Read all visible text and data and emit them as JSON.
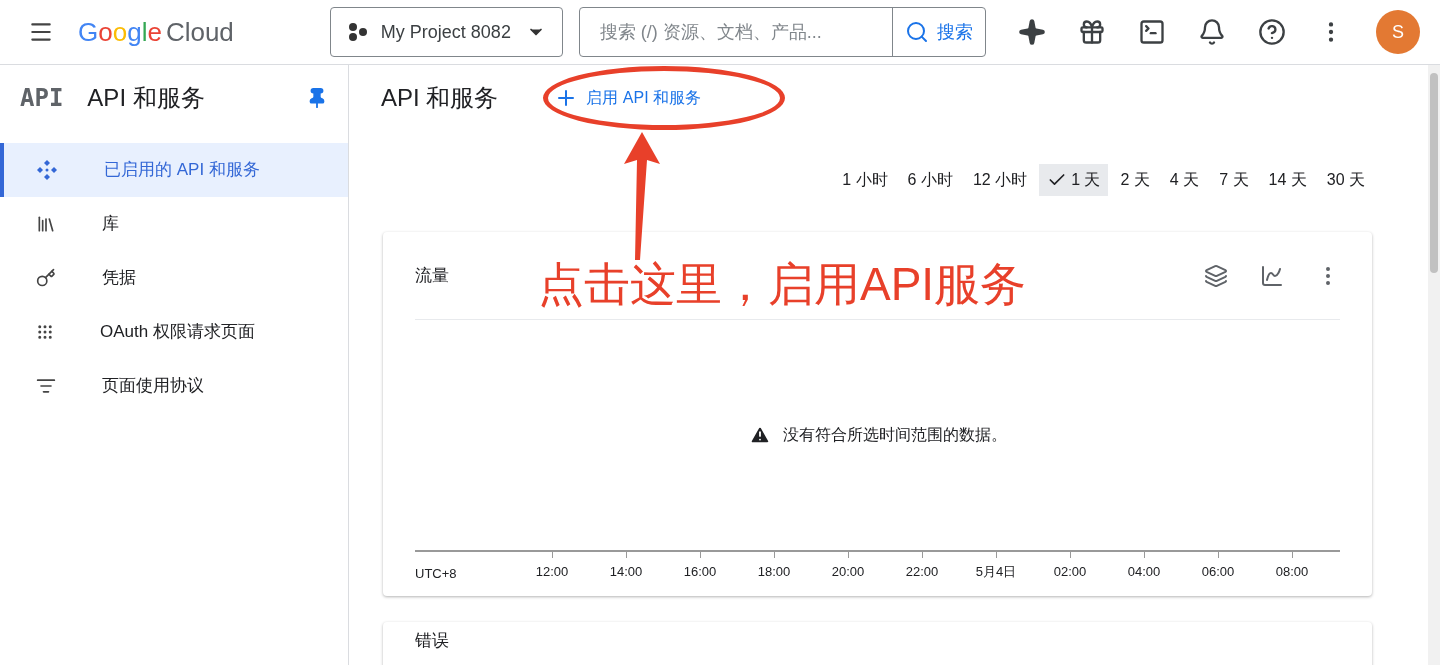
{
  "header": {
    "logo": {
      "brand": "Google",
      "product": "Cloud"
    },
    "project": "My Project 8082",
    "search": {
      "placeholder": "搜索 (/) 资源、文档、产品...",
      "button": "搜索"
    },
    "avatar": "S"
  },
  "sidebar": {
    "badge": "API",
    "title": "API 和服务",
    "items": [
      {
        "label": "已启用的 API 和服务",
        "selected": true,
        "kind": "dashboard"
      },
      {
        "label": "库",
        "selected": false,
        "kind": "library"
      },
      {
        "label": "凭据",
        "selected": false,
        "kind": "credentials"
      },
      {
        "label": "OAuth 权限请求页面",
        "selected": false,
        "kind": "consent"
      },
      {
        "label": "页面使用协议",
        "selected": false,
        "kind": "agreements"
      }
    ]
  },
  "page": {
    "title": "API 和服务",
    "enable_button": "启用 API 和服务"
  },
  "time_ranges": [
    {
      "label": "1 小时",
      "selected": false
    },
    {
      "label": "6 小时",
      "selected": false
    },
    {
      "label": "12 小时",
      "selected": false
    },
    {
      "label": "1 天",
      "selected": true
    },
    {
      "label": "2 天",
      "selected": false
    },
    {
      "label": "4 天",
      "selected": false
    },
    {
      "label": "7 天",
      "selected": false
    },
    {
      "label": "14 天",
      "selected": false
    },
    {
      "label": "30 天",
      "selected": false
    }
  ],
  "traffic_card": {
    "title": "流量",
    "empty_message": "没有符合所选时间范围的数据。",
    "timezone": "UTC+8",
    "axis_labels": [
      "12:00",
      "14:00",
      "16:00",
      "18:00",
      "20:00",
      "22:00",
      "5月4日",
      "02:00",
      "04:00",
      "06:00",
      "08:00"
    ]
  },
  "errors_card": {
    "title": "错误"
  },
  "annotation": {
    "text": "点击这里，启用API服务"
  }
}
